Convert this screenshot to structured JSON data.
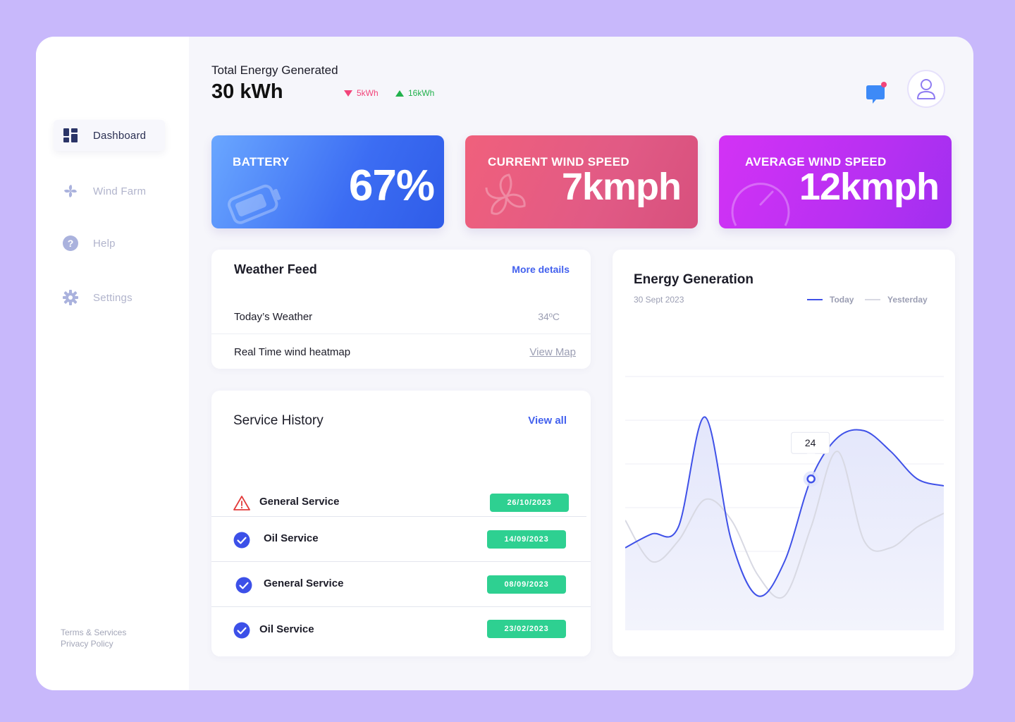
{
  "sidebar": {
    "items": [
      {
        "label": "Dashboard",
        "icon": "dashboard-icon",
        "active": true
      },
      {
        "label": "Wind Farm",
        "icon": "fan-icon",
        "active": false
      },
      {
        "label": "Help",
        "icon": "help-icon",
        "active": false
      },
      {
        "label": "Settings",
        "icon": "gear-icon",
        "active": false
      }
    ],
    "footer": {
      "terms": "Terms & Services",
      "privacy": "Privacy Policy"
    }
  },
  "header": {
    "title": "Total Energy Generated",
    "value": "30 kWh",
    "delta_down": "5kWh",
    "delta_up": "16kWh",
    "chat_icon": "chat-icon",
    "avatar_icon": "user-icon"
  },
  "stats": {
    "battery": {
      "label": "BATTERY",
      "value": "67%",
      "icon": "battery-icon"
    },
    "current_wind": {
      "label": "CURRENT WIND SPEED",
      "value": "7kmph",
      "icon": "fan-icon"
    },
    "average_wind": {
      "label": "AVERAGE WIND SPEED",
      "value": "12kmph",
      "icon": "gauge-icon"
    }
  },
  "weather": {
    "title": "Weather Feed",
    "more": "More details",
    "today_label": "Today’s Weather",
    "today_value": "34ºC",
    "heatmap_label": "Real Time wind heatmap",
    "heatmap_link": "View Map"
  },
  "service": {
    "title": "Service History",
    "view_all": "View all",
    "rows": [
      {
        "name": "General Service",
        "date": "26/10/2023",
        "status": "warning"
      },
      {
        "name": "Oil Service",
        "date": "14/09/2023",
        "status": "done"
      },
      {
        "name": "General Service",
        "date": "08/09/2023",
        "status": "done"
      },
      {
        "name": "Oil Service",
        "date": "23/02/2023",
        "status": "done"
      }
    ]
  },
  "energy": {
    "title": "Energy Generation",
    "date": "30 Sept 2023",
    "legend_today": "Today",
    "legend_yesterday": "Yesterday",
    "tooltip": "24"
  },
  "chart_data": {
    "type": "area",
    "title": "Energy Generation",
    "subtitle": "30 Sept 2023",
    "x": [
      0,
      1,
      2,
      3,
      4,
      5,
      6,
      7,
      8,
      9,
      10,
      11,
      12
    ],
    "series": [
      {
        "name": "Today",
        "values": [
          12.0,
          14.0,
          15.0,
          31.0,
          13.0,
          5.0,
          10.0,
          22.0,
          28.0,
          29.0,
          26.0,
          22.0,
          21.0
        ]
      },
      {
        "name": "Yesterday",
        "values": [
          16.0,
          10.0,
          13.0,
          19.0,
          16.0,
          8.0,
          5.0,
          15.0,
          26.0,
          13.0,
          12.0,
          15.0,
          17.0
        ]
      }
    ],
    "highlight": {
      "series": "Today",
      "x": 7,
      "label": "24"
    },
    "ylim": [
      0,
      42
    ],
    "grid": true,
    "legend": "top-right",
    "colors": {
      "Today": "#3f51e8",
      "Yesterday": "#d8d9e3"
    }
  },
  "colors": {
    "accent": "#4361ee",
    "success": "#2ed091",
    "warning": "#e23c3c",
    "down": "#f2457a",
    "up": "#22b14c"
  }
}
